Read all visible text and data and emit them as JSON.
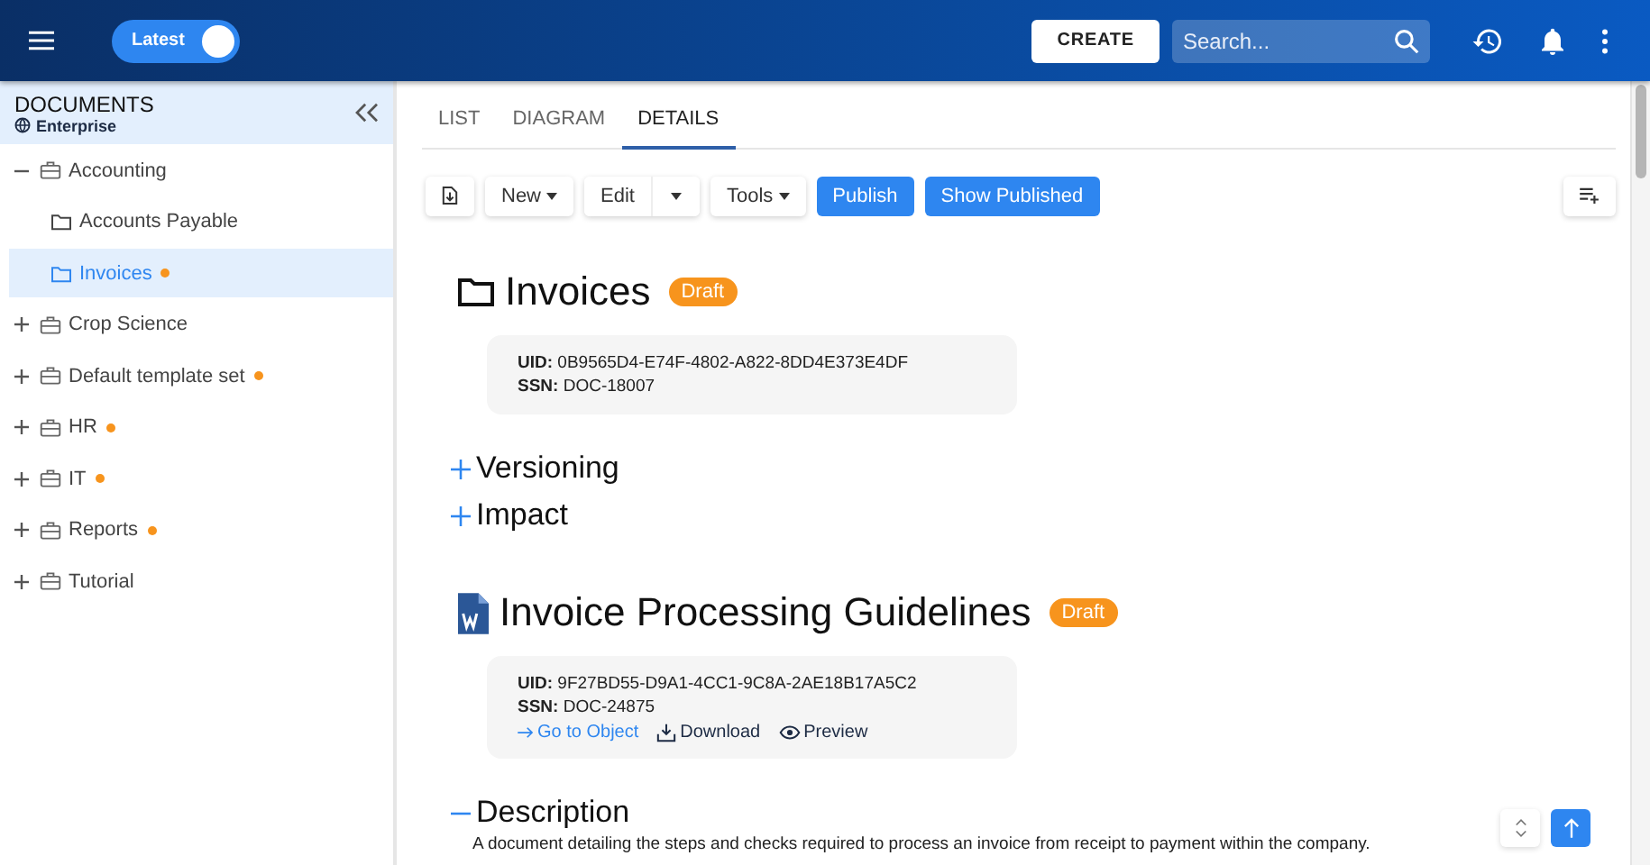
{
  "topbar": {
    "version_toggle": {
      "label": "Latest",
      "on": true
    },
    "create_button": "CREATE",
    "search": {
      "placeholder": "Search..."
    }
  },
  "sidebar": {
    "title": "DOCUMENTS",
    "subtitle": "Enterprise",
    "tree": [
      {
        "label": "Accounting",
        "kind": "category",
        "expanded": true,
        "selected": false,
        "flagged": false,
        "children": [
          {
            "label": "Accounts Payable",
            "kind": "folder",
            "selected": false,
            "flagged": false
          },
          {
            "label": "Invoices",
            "kind": "folder",
            "selected": true,
            "flagged": true
          }
        ]
      },
      {
        "label": "Crop Science",
        "kind": "category",
        "expanded": false,
        "selected": false,
        "flagged": false
      },
      {
        "label": "Default template set",
        "kind": "category",
        "expanded": false,
        "selected": false,
        "flagged": true
      },
      {
        "label": "HR",
        "kind": "category",
        "expanded": false,
        "selected": false,
        "flagged": true
      },
      {
        "label": "IT",
        "kind": "category",
        "expanded": false,
        "selected": false,
        "flagged": true
      },
      {
        "label": "Reports",
        "kind": "category",
        "expanded": false,
        "selected": false,
        "flagged": true
      },
      {
        "label": "Tutorial",
        "kind": "category",
        "expanded": false,
        "selected": false,
        "flagged": false
      }
    ]
  },
  "tabs": [
    {
      "label": "LIST",
      "selected": false
    },
    {
      "label": "DIAGRAM",
      "selected": false
    },
    {
      "label": "DETAILS",
      "selected": true
    }
  ],
  "toolbar": [
    {
      "kind": "icon"
    },
    {
      "kind": "menu",
      "label": "New"
    },
    {
      "kind": "split",
      "label": "Edit"
    },
    {
      "kind": "menu",
      "label": "Tools"
    },
    {
      "kind": "primary",
      "label": "Publish"
    },
    {
      "kind": "primary",
      "label": "Show Published"
    }
  ],
  "blocks": [
    {
      "kind": "folder",
      "title": "Invoices",
      "status": "Draft",
      "uid_label": "UID:",
      "uid": "0B9565D4-E74F-4802-A822-8DD4E373E4DF",
      "ssn_label": "SSN:",
      "ssn": "DOC-18007"
    },
    {
      "kind": "section",
      "title": "Versioning",
      "expanded": false
    },
    {
      "kind": "section",
      "title": "Impact",
      "expanded": false
    },
    {
      "kind": "document",
      "title": "Invoice Processing Guidelines",
      "status": "Draft",
      "uid_label": "UID:",
      "uid": "9F27BD55-D9A1-4CC1-9C8A-2AE18B17A5C2",
      "ssn_label": "SSN:",
      "ssn": "DOC-24875",
      "links": [
        "Go to Object",
        "Download",
        "Preview"
      ]
    },
    {
      "kind": "section",
      "title": "Description",
      "expanded": true,
      "text": "A document detailing the steps and checks required to process an invoice from receipt to payment within the company."
    }
  ]
}
